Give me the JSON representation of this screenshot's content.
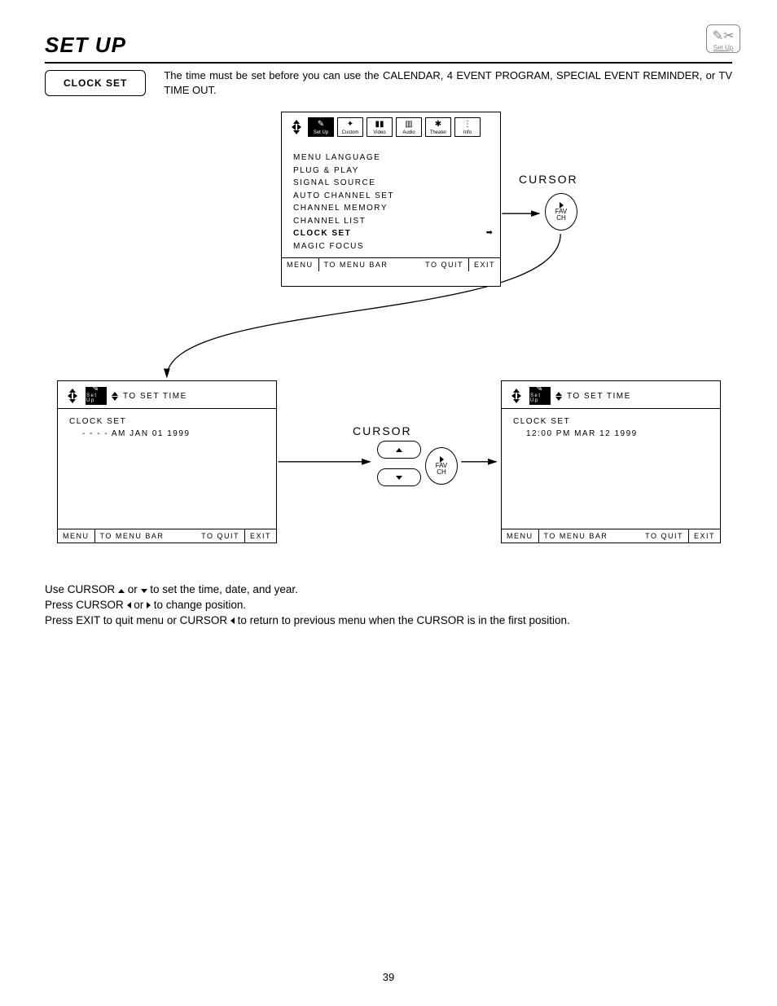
{
  "page_title": "SET UP",
  "corner_icon_label": "Set Up",
  "section_button": "CLOCK SET",
  "intro": "The time must be set before you can use the CALENDAR, 4 EVENT PROGRAM, SPECIAL EVENT REMINDER, or TV TIME OUT.",
  "top_screen": {
    "tabs": [
      "Set Up",
      "Custom",
      "Video",
      "Audio",
      "Theater",
      "Info"
    ],
    "menu_items": [
      "MENU LANGUAGE",
      "PLUG & PLAY",
      "SIGNAL SOURCE",
      "AUTO CHANNEL SET",
      "CHANNEL MEMORY",
      "CHANNEL LIST",
      "CLOCK SET",
      "MAGIC FOCUS"
    ],
    "selected": "CLOCK SET",
    "footer": {
      "menu": "MENU",
      "mid": "TO MENU BAR",
      "quit": "TO QUIT",
      "exit": "EXIT"
    }
  },
  "cursor_label": "CURSOR",
  "fav_label1": "FAV",
  "fav_label2": "CH",
  "set_time_label": "TO SET TIME",
  "bottom_left": {
    "title": "CLOCK SET",
    "value": "- -  - - AM JAN 01 1999",
    "footer": {
      "menu": "MENU",
      "mid": "TO MENU BAR",
      "quit": "TO QUIT",
      "exit": "EXIT"
    }
  },
  "bottom_right": {
    "title": "CLOCK SET",
    "value": "12:00 PM MAR 12 1999",
    "footer": {
      "menu": "MENU",
      "mid": "TO MENU BAR",
      "quit": "TO QUIT",
      "exit": "EXIT"
    }
  },
  "instructions": {
    "line1_pre": "Use CURSOR ",
    "line1_mid": " or ",
    "line1_post": " to set the time, date, and year.",
    "line2_pre": "Press CURSOR ",
    "line2_mid": " or ",
    "line2_post": " to change position.",
    "line3_pre": "Press EXIT to quit menu or CURSOR ",
    "line3_post": " to return to previous menu when the CURSOR is in the first position."
  },
  "page_number": "39"
}
